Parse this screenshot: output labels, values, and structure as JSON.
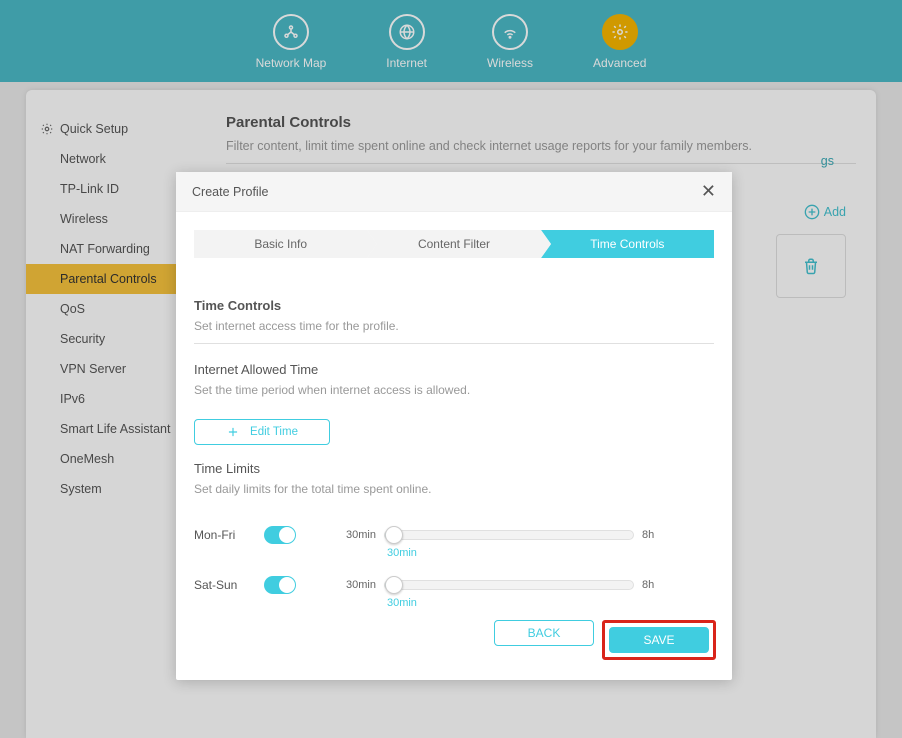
{
  "nav": {
    "items": [
      {
        "id": "network-map",
        "label": "Network Map"
      },
      {
        "id": "internet",
        "label": "Internet"
      },
      {
        "id": "wireless",
        "label": "Wireless"
      },
      {
        "id": "advanced",
        "label": "Advanced"
      }
    ]
  },
  "sidebar": {
    "items": [
      "Quick Setup",
      "Network",
      "TP-Link ID",
      "Wireless",
      "NAT Forwarding",
      "Parental Controls",
      "QoS",
      "Security",
      "VPN Server",
      "IPv6",
      "Smart Life Assistant",
      "OneMesh",
      "System"
    ]
  },
  "content": {
    "title": "Parental Controls",
    "desc": "Filter content, limit time spent online and check internet usage reports for your family members.",
    "settings_hint": "gs",
    "add_label": "Add"
  },
  "modal": {
    "title": "Create Profile",
    "tabs": [
      "Basic Info",
      "Content Filter",
      "Time Controls"
    ],
    "section1_h": "Time Controls",
    "section1_d": "Set internet access time for the profile.",
    "section2_h": "Internet Allowed Time",
    "section2_d": "Set the time period when internet access is allowed.",
    "edit_label": "Edit Time",
    "section3_h": "Time Limits",
    "section3_d": "Set daily limits for the total time spent online.",
    "limits": {
      "weekday_label": "Mon-Fri",
      "weekend_label": "Sat-Sun",
      "min": "30min",
      "max": "8h",
      "weekday_value": "30min",
      "weekend_value": "30min"
    },
    "back": "BACK",
    "save": "SAVE"
  },
  "colors": {
    "accent": "#40cde0",
    "brand_yellow": "#f5b400"
  }
}
